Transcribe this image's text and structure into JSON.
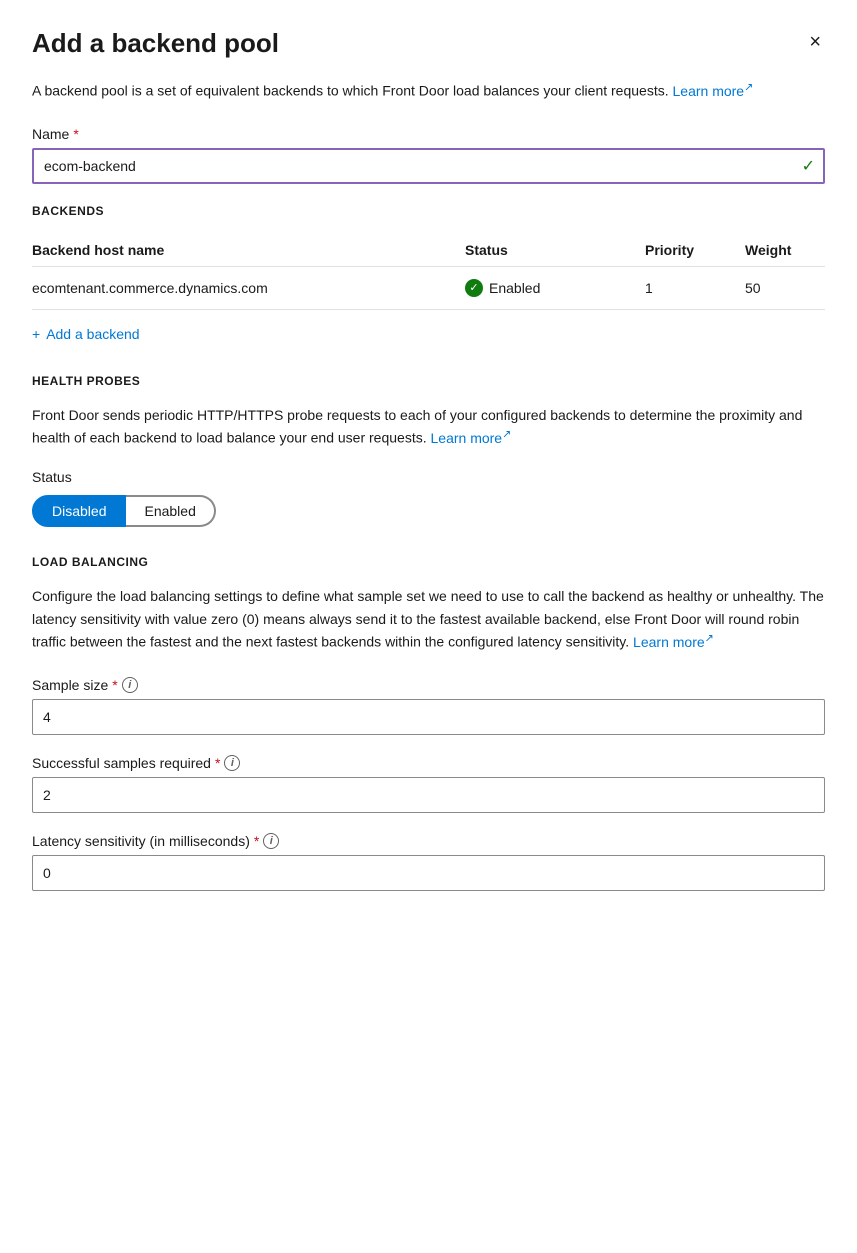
{
  "panel": {
    "title": "Add a backend pool",
    "close_label": "×"
  },
  "description": {
    "text": "A backend pool is a set of equivalent backends to which Front Door load balances your client requests.",
    "learn_more_label": "Learn more",
    "learn_more_ext": "↗"
  },
  "name_field": {
    "label": "Name",
    "required": "*",
    "value": "ecom-backend",
    "check_icon": "✓"
  },
  "backends_section": {
    "heading": "BACKENDS",
    "table": {
      "columns": [
        "Backend host name",
        "Status",
        "Priority",
        "Weight"
      ],
      "rows": [
        {
          "host": "ecomtenant.commerce.dynamics.com",
          "status": "Enabled",
          "priority": "1",
          "weight": "50"
        }
      ]
    },
    "add_button_label": "Add a backend",
    "add_icon": "+"
  },
  "health_probes_section": {
    "heading": "HEALTH PROBES",
    "description": "Front Door sends periodic HTTP/HTTPS probe requests to each of your configured backends to determine the proximity and health of each backend to load balance your end user requests.",
    "learn_more_label": "Learn more",
    "learn_more_ext": "↗",
    "status_label": "Status",
    "toggle_disabled": "Disabled",
    "toggle_enabled": "Enabled",
    "active_toggle": "disabled"
  },
  "load_balancing_section": {
    "heading": "LOAD BALANCING",
    "description": "Configure the load balancing settings to define what sample set we need to use to call the backend as healthy or unhealthy. The latency sensitivity with value zero (0) means always send it to the fastest available backend, else Front Door will round robin traffic between the fastest and the next fastest backends within the configured latency sensitivity.",
    "learn_more_label": "Learn more",
    "learn_more_ext": "↗",
    "sample_size": {
      "label": "Sample size",
      "required": "*",
      "value": "4"
    },
    "successful_samples": {
      "label": "Successful samples required",
      "required": "*",
      "value": "2"
    },
    "latency_sensitivity": {
      "label": "Latency sensitivity (in milliseconds)",
      "required": "*",
      "value": "0"
    }
  }
}
